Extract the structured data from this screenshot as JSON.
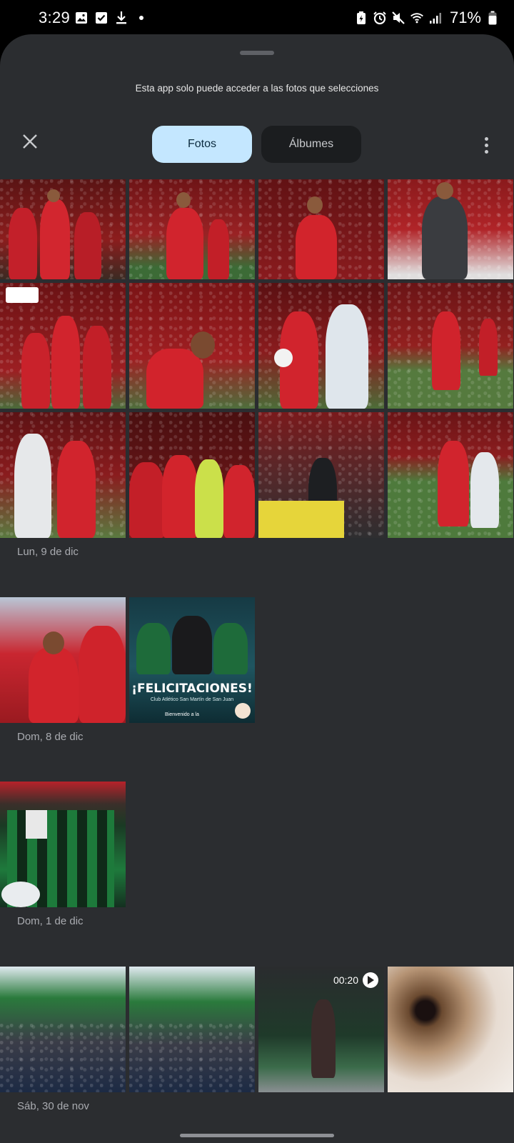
{
  "status_bar": {
    "time": "3:29",
    "battery": "71%",
    "left_icons": [
      "image-icon",
      "check-square-icon",
      "download-icon",
      "dot-icon"
    ],
    "right_icons": [
      "battery-saver-icon",
      "alarm-icon",
      "mute-icon",
      "wifi-icon",
      "signal-icon",
      "battery-icon"
    ]
  },
  "sheet": {
    "notice": "Esta app solo puede acceder a las fotos que selecciones"
  },
  "toolbar": {
    "close_icon": "close-icon",
    "tabs": [
      {
        "label": "Fotos",
        "selected": true
      },
      {
        "label": "Álbumes",
        "selected": false
      }
    ],
    "more_icon": "more-vert-icon"
  },
  "sections": [
    {
      "label": "Lun, 9 de dic",
      "photo_count": 12
    },
    {
      "label": "Dom, 8 de dic",
      "photo_count": 2
    },
    {
      "label": "Dom, 1 de dic",
      "photo_count": 1
    },
    {
      "label": "Sáb, 30 de nov",
      "photo_count": 4
    }
  ],
  "photos": {
    "felicitaciones_title": "¡FELICITACIONES!",
    "felicitaciones_sub": "Club Atlético San Martín de San Juan",
    "felicitaciones_foot": "Bienvenido a la",
    "video_duration": "00:20"
  },
  "colors": {
    "sheet_bg": "#2b2d30",
    "tab_selected_bg": "#c4e7ff",
    "tab_unselected_bg": "#1b1d1f"
  }
}
